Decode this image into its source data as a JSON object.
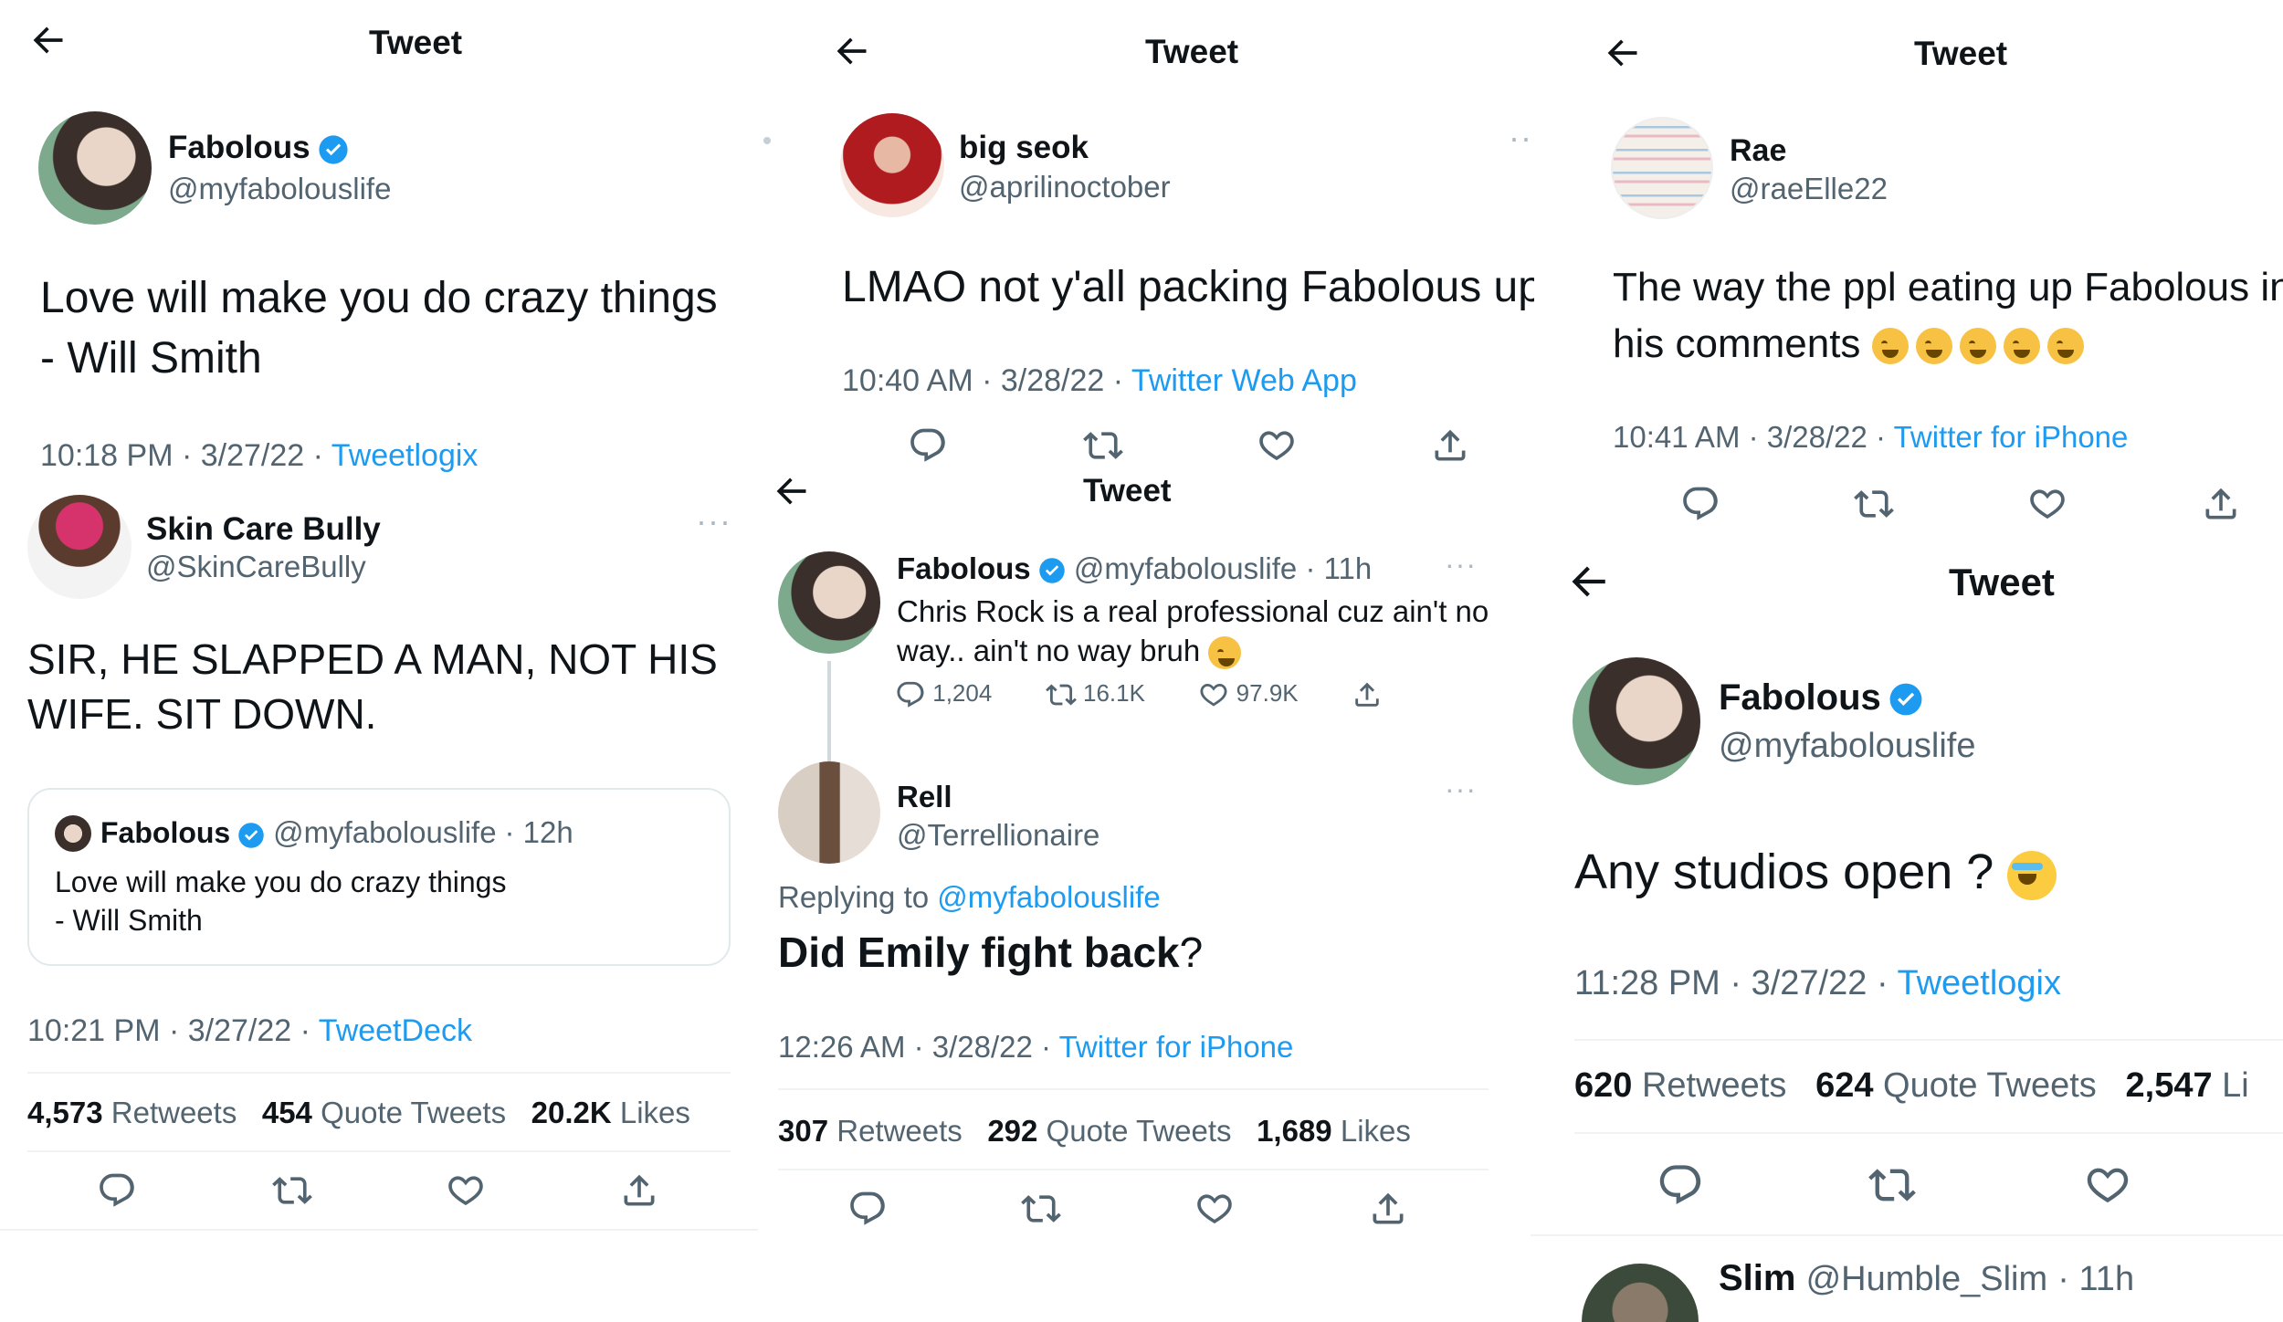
{
  "header_title": "Tweet",
  "panel1": {
    "name": "Fabolous",
    "handle": "@myfabolouslife",
    "text": "Love will make you do crazy things\n- Will Smith",
    "time": "10:18 PM · 3/27/22 · ",
    "source": "Tweetlogix"
  },
  "panel2": {
    "name": "big seok",
    "handle": "@aprilinoctober",
    "text": "LMAO not y'all packing Fabolous up",
    "time": "10:40 AM · 3/28/22 · ",
    "source": "Twitter Web App"
  },
  "panel3": {
    "name": "Rae",
    "handle": "@raeElle22",
    "text1": "The way the ppl eating up Fabolous in",
    "text2": "his comments",
    "time": "10:41 AM · 3/28/22 · ",
    "source": "Twitter for iPhone"
  },
  "panel4": {
    "name": "Skin Care Bully",
    "handle": "@SkinCareBully",
    "text": "SIR, HE SLAPPED A MAN, NOT HIS WIFE. SIT DOWN.",
    "quote": {
      "name": "Fabolous",
      "handle": "@myfabolouslife",
      "time": "· 12h",
      "text": "Love will make you do crazy things\n- Will Smith"
    },
    "time": "10:21 PM · 3/27/22 · ",
    "source": "TweetDeck",
    "retweets": "4,573",
    "retweets_label": "Retweets",
    "quotes": "454",
    "quotes_label": "Quote Tweets",
    "likes": "20.2K",
    "likes_label": "Likes"
  },
  "panel5": {
    "parent": {
      "name": "Fabolous",
      "handle": "@myfabolouslife",
      "time": "· 11h",
      "text": "Chris Rock is a real professional cuz ain't no way.. ain't no way bruh",
      "replies": "1,204",
      "retweets": "16.1K",
      "likes": "97.9K"
    },
    "name": "Rell",
    "handle": "@Terrellionaire",
    "replying_prefix": "Replying to ",
    "replying_handle": "@myfabolouslife",
    "text_bold": "Did Emily fight back",
    "text_tail": "?",
    "time": "12:26 AM · 3/28/22 · ",
    "source": "Twitter for iPhone",
    "retweets": "307",
    "retweets_label": "Retweets",
    "quotes": "292",
    "quotes_label": "Quote Tweets",
    "likes": "1,689",
    "likes_label": "Likes"
  },
  "panel6": {
    "name": "Fabolous",
    "handle": "@myfabolouslife",
    "text": "Any studios open ?",
    "time": "11:28 PM · 3/27/22 · ",
    "source": "Tweetlogix",
    "retweets": "620",
    "retweets_label": "Retweets",
    "quotes": "624",
    "quotes_label": "Quote Tweets",
    "likes": "2,547",
    "likes_label": "Li",
    "next_name": "Slim",
    "next_handle": "@Humble_Slim",
    "next_time": "· 11h"
  },
  "colors": {
    "accent": "#1d9bf0",
    "secondary": "#536471",
    "divider": "#eff3f4"
  }
}
